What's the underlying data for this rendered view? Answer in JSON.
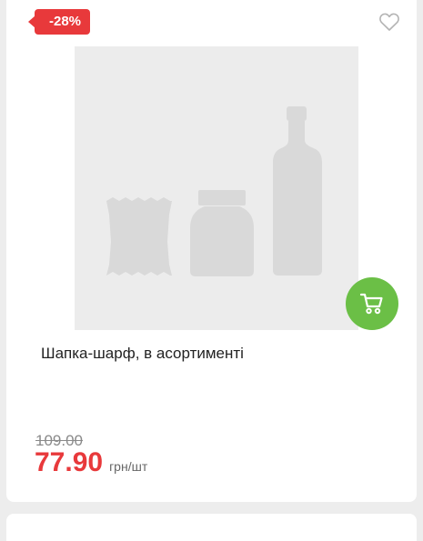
{
  "product": {
    "discount_badge": "-28%",
    "name": "Шапка-шарф, в асортименті",
    "old_price": "109.00",
    "price": "77.90",
    "unit": "грн/шт"
  },
  "icons": {
    "wishlist": "heart-outline-icon",
    "cart": "shopping-cart-icon",
    "placeholder": "product-placeholder-image"
  },
  "colors": {
    "discount": "#e8393b",
    "price": "#e8393b",
    "cart_button": "#6bbf46",
    "placeholder_bg": "#ececec",
    "placeholder_shapes": "#d9d9d9"
  }
}
